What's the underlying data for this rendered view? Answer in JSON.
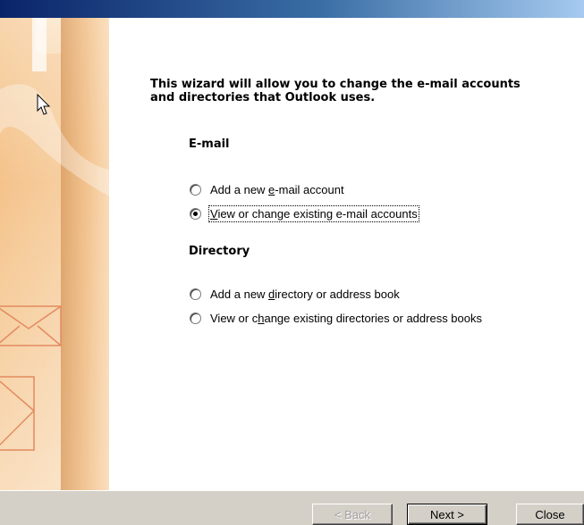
{
  "window": {
    "intro_text": "This wizard will allow you to change the e-mail accounts and directories that Outlook uses."
  },
  "email_group": {
    "title": "E-mail",
    "options": [
      {
        "prefix": "Add a new ",
        "accel": "e",
        "suffix": "-mail account",
        "checked": false
      },
      {
        "prefix": "",
        "accel": "V",
        "suffix": "iew or change existing e-mail accounts",
        "checked": true
      }
    ]
  },
  "directory_group": {
    "title": "Directory",
    "options": [
      {
        "prefix": "Add a new ",
        "accel": "d",
        "suffix": "irectory or address book",
        "checked": false
      },
      {
        "prefix": "View or c",
        "accel": "h",
        "suffix": "ange existing directories or address books",
        "checked": false
      }
    ]
  },
  "buttons": {
    "back_label": "< Back",
    "next_label": "Next >",
    "close_label": "Close"
  },
  "colors": {
    "titlebar_start": "#0a246a",
    "banner_orange": "#e8953a",
    "dialog_face": "#d4d0c8"
  }
}
